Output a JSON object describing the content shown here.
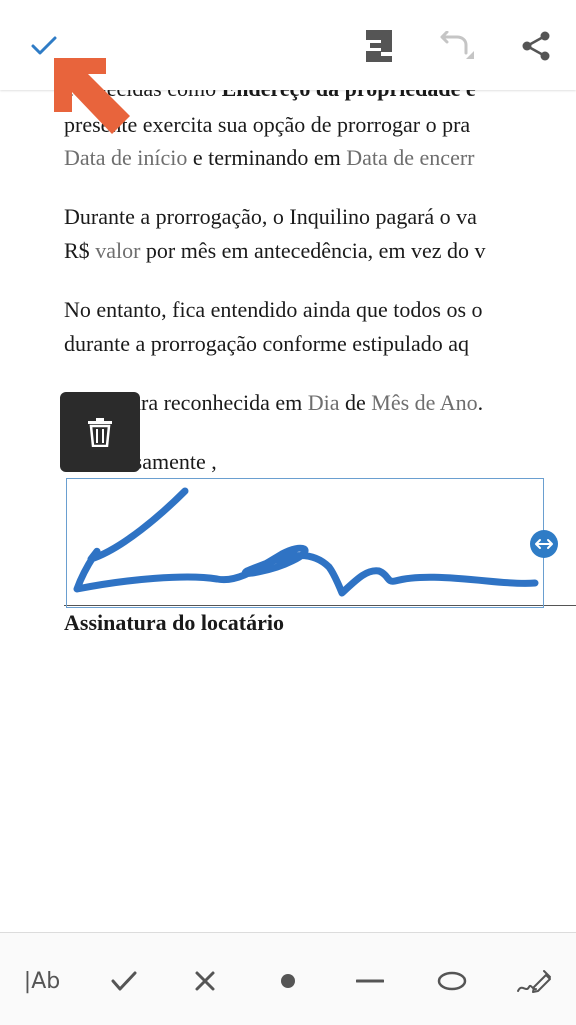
{
  "toolbar": {
    "confirm_icon": "check-icon",
    "save_icon": "save-icon",
    "undo_icon": "undo-icon",
    "share_icon": "share-icon",
    "accent_color": "#2f7cc6"
  },
  "document": {
    "line1_plain": "conhecidas como ",
    "line1_bold": "Endereço da propriedade e",
    "line2": "presente exercita sua opção de prorrogar o pra",
    "line3_ph1": "Data de início",
    "line3_mid": " e terminando em ",
    "line3_ph2": "Data de encerr",
    "para2_line1": "Durante a prorrogação, o Inquilino pagará o va",
    "para2_line2_a": "R$ ",
    "para2_line2_ph": "valor",
    "para2_line2_b": " por mês em antecedência, em vez do v",
    "para3_line1": "No entanto, fica entendido ainda que todos os o",
    "para3_line2": "durante a prorrogação conforme estipulado aq",
    "para4_a": "Assinatura reconhecida em ",
    "para4_ph1": "Dia",
    "para4_b": " de ",
    "para4_ph2": "Mês de Ano",
    "para4_c": ".",
    "closing": "Atenciosamente ,",
    "signature_label": "Assinatura do locatário"
  },
  "signature": {
    "delete_icon": "trash-icon",
    "resize_icon": "resize-horizontal-icon",
    "ink_color": "#2f73c4"
  },
  "annotation": {
    "arrow_color": "#e8643c"
  },
  "tools": {
    "text_label": "|Ab",
    "check_icon": "checkmark-icon",
    "cross_icon": "cross-icon",
    "dot_icon": "dot-icon",
    "line_icon": "line-icon",
    "ellipse_icon": "ellipse-icon",
    "sign_icon": "signature-pen-icon"
  }
}
